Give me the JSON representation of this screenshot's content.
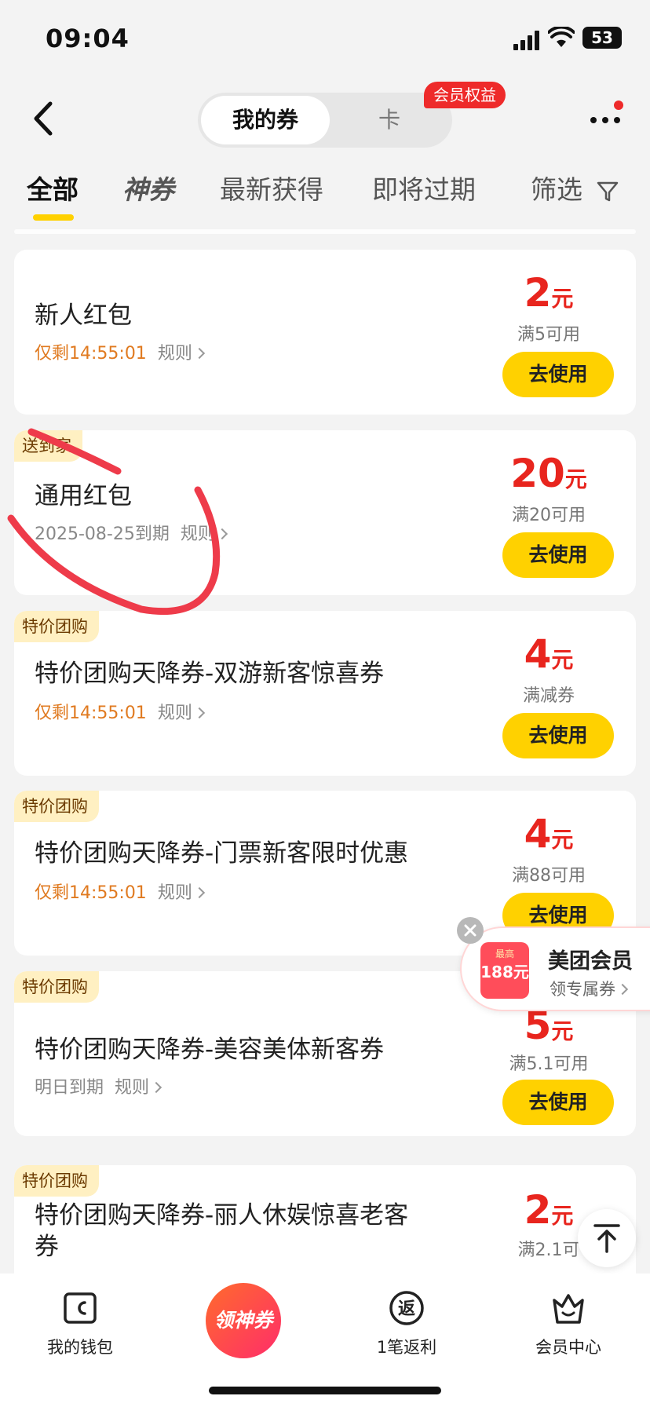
{
  "status": {
    "time": "09:04",
    "battery": "53"
  },
  "nav": {
    "tab_active": "我的券",
    "tab_card": "卡",
    "vip_badge": "会员权益"
  },
  "filters": {
    "all": "全部",
    "shen": "神券",
    "newest": "最新获得",
    "expiring": "即将过期",
    "filter": "筛选"
  },
  "coupons": [
    {
      "tag": "",
      "title": "新人红包",
      "date": "仅剩14:55:01",
      "rule": "规则",
      "amount": "2",
      "unit": "元",
      "condition": "满5可用",
      "button": "去使用"
    },
    {
      "tag": "送到家",
      "title": "通用红包",
      "date": "2025-08-25到期",
      "rule": "规则",
      "amount": "20",
      "unit": "元",
      "condition": "满20可用",
      "button": "去使用"
    },
    {
      "tag": "特价团购",
      "title": "特价团购天降券-双游新客惊喜券",
      "date": "仅剩14:55:01",
      "rule": "规则",
      "amount": "4",
      "unit": "元",
      "condition": "满减券",
      "button": "去使用"
    },
    {
      "tag": "特价团购",
      "title": "特价团购天降券-门票新客限时优惠",
      "date": "仅剩14:55:01",
      "rule": "规则",
      "amount": "4",
      "unit": "元",
      "condition": "满88可用",
      "button": "去使用"
    },
    {
      "tag": "特价团购",
      "title": "特价团购天降券-美容美体新客券",
      "date": "明日到期",
      "rule": "规则",
      "amount": "5",
      "unit": "元",
      "condition": "满5.1可用",
      "button": "去使用"
    },
    {
      "tag": "特价团购",
      "title_line1": "特价团购天降券-丽人休娱惊喜老客",
      "title_line2": "券",
      "amount": "2",
      "unit": "元",
      "condition": "满2.1可"
    }
  ],
  "member_popup": {
    "img_top": "最高",
    "img_num": "188元",
    "title": "美团会员",
    "subtitle": "领专属券"
  },
  "bottom_bar": {
    "wallet": "我的钱包",
    "center": "领神券",
    "rebate": "1笔返利",
    "rebate_icon": "返",
    "member": "会员中心"
  }
}
